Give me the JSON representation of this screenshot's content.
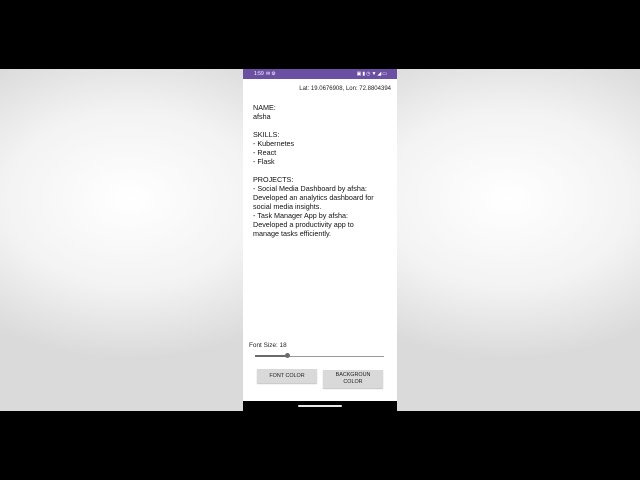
{
  "status_bar": {
    "time": "1:59",
    "left_icons": [
      "message-icon",
      "settings-icon"
    ],
    "right_icons": [
      "cast-icon",
      "vibrate-icon",
      "alarm-icon",
      "wifi-icon",
      "signal-icon",
      "battery-icon"
    ],
    "background": "#6a4fa3"
  },
  "location": {
    "text": "Lat: 19.0676908, Lon: 72.8804394"
  },
  "resume": {
    "name_heading": "NAME:",
    "name_value": "afsha",
    "skills_heading": "SKILLS:",
    "skills": [
      "- Kubernetes",
      "- React",
      "- Flask"
    ],
    "projects_heading": "PROJECTS:",
    "projects": [
      "- Social Media Dashboard by afsha:",
      "Developed an analytics dashboard for",
      "social media insights.",
      "- Task Manager App by afsha:",
      "Developed a productivity app to",
      "manage tasks efficiently."
    ]
  },
  "font_size": {
    "label": "Font Size: 18",
    "slider_value_fraction": 0.25
  },
  "buttons": {
    "font_color": "FONT COLOR",
    "background_color_line1": "BACKGROUN",
    "background_color_line2": "COLOR"
  }
}
